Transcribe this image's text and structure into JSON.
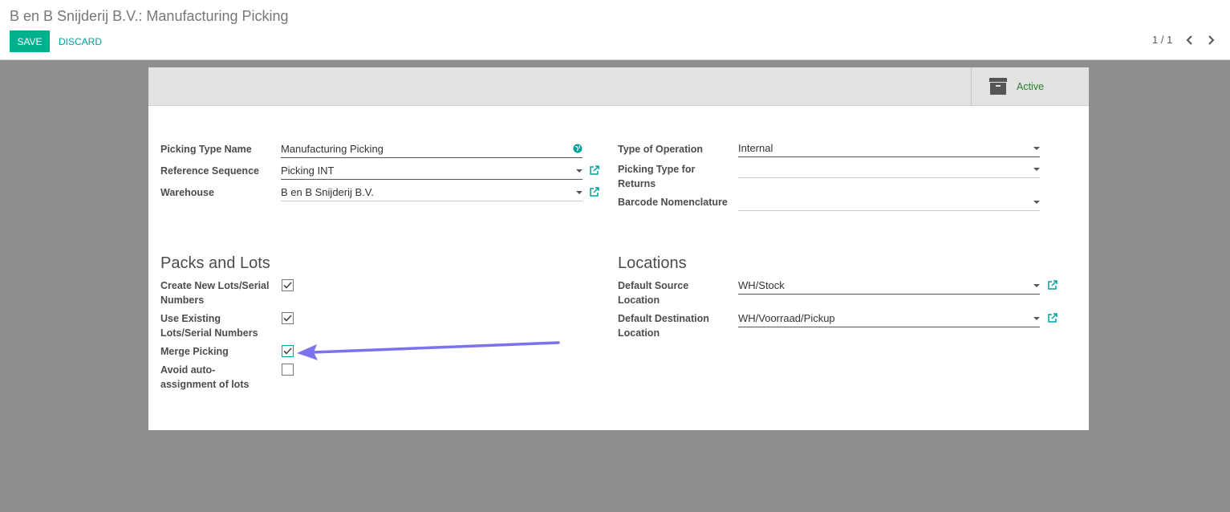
{
  "breadcrumb": "B en B Snijderij B.V.: Manufacturing Picking",
  "toolbar": {
    "save_label": "SAVE",
    "discard_label": "DISCARD"
  },
  "pager": {
    "value": "1 / 1"
  },
  "button_box": {
    "active_label": "Active"
  },
  "form": {
    "left": {
      "picking_type_name": {
        "label": "Picking Type Name",
        "value": "Manufacturing Picking"
      },
      "reference_sequence": {
        "label": "Reference Sequence",
        "value": "Picking INT"
      },
      "warehouse": {
        "label": "Warehouse",
        "value": "B en B Snijderij B.V."
      }
    },
    "right": {
      "type_of_operation": {
        "label": "Type of Operation",
        "value": "Internal"
      },
      "picking_type_returns": {
        "label_line1": "Picking Type for",
        "label_line2": "Returns",
        "value": ""
      },
      "barcode_nomenclature": {
        "label": "Barcode Nomenclature",
        "value": ""
      }
    }
  },
  "packs_and_lots": {
    "title": "Packs and Lots",
    "items": [
      {
        "line1": "Create New Lots/Serial",
        "line2": "Numbers",
        "checked": true
      },
      {
        "line1": "Use Existing",
        "line2": "Lots/Serial Numbers",
        "checked": true
      },
      {
        "line1": "Merge Picking",
        "line2": "",
        "checked": true
      },
      {
        "line1": "Avoid auto-",
        "line2": "assignment of lots",
        "checked": false
      }
    ]
  },
  "locations": {
    "title": "Locations",
    "default_source": {
      "label_line1": "Default Source",
      "label_line2": "Location",
      "value": "WH/Stock"
    },
    "default_destination": {
      "label_line1": "Default Destination",
      "label_line2": "Location",
      "value": "WH/Voorraad/Pickup"
    }
  },
  "colors": {
    "primary": "#00b08e",
    "link": "#00a09d",
    "annotation_arrow": "#7b72f0",
    "active": "#2e7d32"
  }
}
